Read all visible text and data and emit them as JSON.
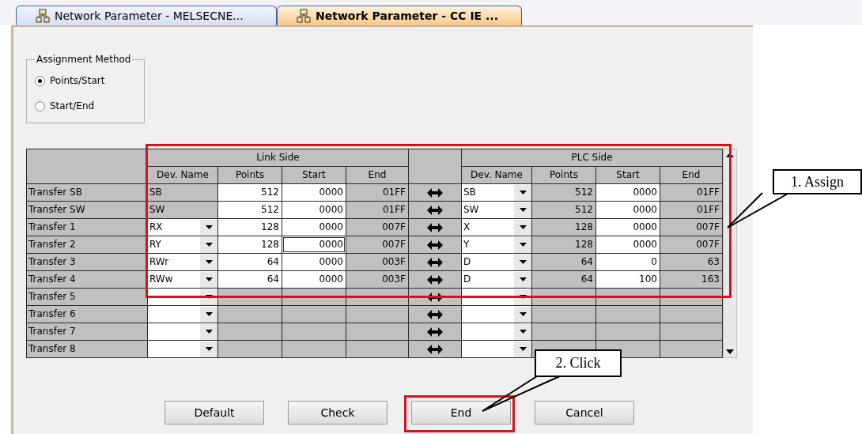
{
  "tabs": [
    {
      "label": "Network Parameter - MELSECNE...",
      "selected": false
    },
    {
      "label": "Network Parameter - CC IE ...",
      "selected": true
    }
  ],
  "assignment_method": {
    "title": "Assignment Method",
    "options": [
      {
        "label": "Points/Start",
        "selected": true
      },
      {
        "label": "Start/End",
        "selected": false
      }
    ]
  },
  "table": {
    "link_header": "Link Side",
    "plc_header": "PLC Side",
    "link_columns": [
      "Dev. Name",
      "Points",
      "Start",
      "End"
    ],
    "plc_columns": [
      "Dev. Name",
      "Points",
      "Start",
      "End"
    ],
    "rows": [
      {
        "label": "Transfer SB",
        "link": {
          "kind": "fixed",
          "dev": "SB",
          "points": "512",
          "start": "0000",
          "end": "01FF"
        },
        "plc": {
          "kind": "dropdown",
          "dev": "SB",
          "points": "512",
          "start": "0000",
          "end": "01FF"
        }
      },
      {
        "label": "Transfer SW",
        "link": {
          "kind": "fixed",
          "dev": "SW",
          "points": "512",
          "start": "0000",
          "end": "01FF"
        },
        "plc": {
          "kind": "dropdown",
          "dev": "SW",
          "points": "512",
          "start": "0000",
          "end": "01FF"
        }
      },
      {
        "label": "Transfer 1",
        "link": {
          "kind": "dropdown",
          "dev": "RX",
          "points": "128",
          "start": "0000",
          "end": "007F"
        },
        "plc": {
          "kind": "dropdown",
          "dev": "X",
          "points": "128",
          "start": "0000",
          "end": "007F"
        }
      },
      {
        "label": "Transfer 2",
        "link": {
          "kind": "dropdown",
          "dev": "RY",
          "points": "128",
          "start": "0000",
          "end": "007F",
          "focused": true
        },
        "plc": {
          "kind": "dropdown",
          "dev": "Y",
          "points": "128",
          "start": "0000",
          "end": "007F"
        }
      },
      {
        "label": "Transfer 3",
        "link": {
          "kind": "dropdown",
          "dev": "RWr",
          "points": "64",
          "start": "0000",
          "end": "003F"
        },
        "plc": {
          "kind": "dropdown",
          "dev": "D",
          "points": "64",
          "start": "0",
          "end": "63"
        }
      },
      {
        "label": "Transfer 4",
        "link": {
          "kind": "dropdown",
          "dev": "RWw",
          "points": "64",
          "start": "0000",
          "end": "003F"
        },
        "plc": {
          "kind": "dropdown",
          "dev": "D",
          "points": "64",
          "start": "100",
          "end": "163"
        }
      },
      {
        "label": "Transfer 5",
        "link": {
          "kind": "dropdown"
        },
        "plc": {
          "kind": "dropdown"
        }
      },
      {
        "label": "Transfer 6",
        "link": {
          "kind": "dropdown"
        },
        "plc": {
          "kind": "dropdown"
        }
      },
      {
        "label": "Transfer 7",
        "link": {
          "kind": "dropdown"
        },
        "plc": {
          "kind": "dropdown"
        }
      },
      {
        "label": "Transfer 8",
        "link": {
          "kind": "dropdown"
        },
        "plc": {
          "kind": "dropdown"
        }
      }
    ]
  },
  "buttons": [
    "Default",
    "Check",
    "End",
    "Cancel"
  ],
  "annotations": [
    "1. Assign",
    "2. Click"
  ]
}
